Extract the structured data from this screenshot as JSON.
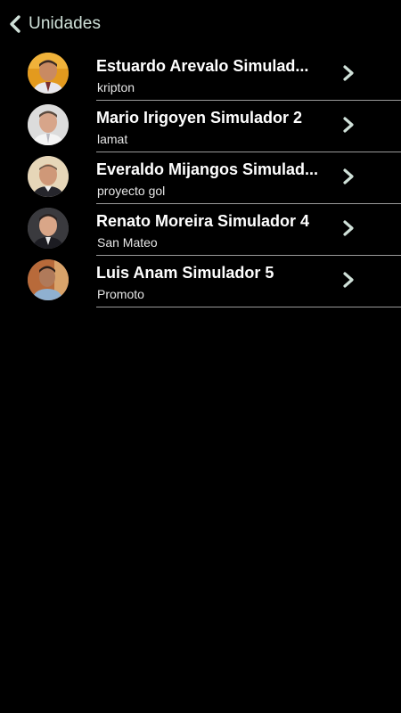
{
  "header": {
    "back_label": "Unidades",
    "accent_color": "#cfe0d8"
  },
  "units": [
    {
      "name": "Estuardo Arevalo Simulad...",
      "subtitle": "kripton",
      "avatar": "person-photo"
    },
    {
      "name": "Mario Irigoyen Simulador 2",
      "subtitle": "lamat",
      "avatar": "person-photo"
    },
    {
      "name": "Everaldo Mijangos Simulad...",
      "subtitle": "proyecto gol",
      "avatar": "person-photo"
    },
    {
      "name": "Renato Moreira Simulador 4",
      "subtitle": "San Mateo",
      "avatar": "person-photo"
    },
    {
      "name": "Luis Anam Simulador 5",
      "subtitle": "Promoto",
      "avatar": "person-photo"
    }
  ]
}
